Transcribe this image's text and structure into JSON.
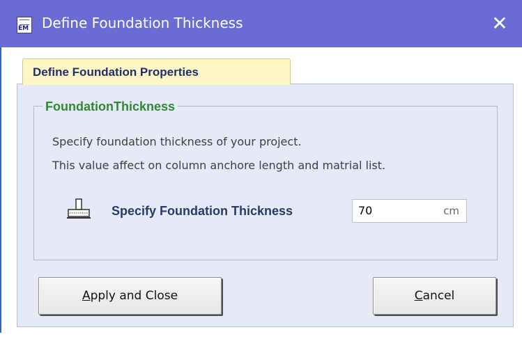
{
  "window": {
    "title": "Define Foundation Thickness",
    "icon_text": "EM",
    "close_glyph": "✕"
  },
  "tab": {
    "label": "Define Foundation Properties"
  },
  "group": {
    "title": "FoundationThickness",
    "description_line1": "Specify foundation thickness of your project.",
    "description_line2": "This value affect on column anchore length and matrial list."
  },
  "field": {
    "label": "Specify Foundation Thickness",
    "value": "70",
    "unit": "cm",
    "icon": "foundation-icon"
  },
  "buttons": {
    "apply_label": "Apply and Close",
    "apply_mnemonic": "A",
    "apply_rest": "pply and Close",
    "cancel_label": "Cancel",
    "cancel_mnemonic": "C",
    "cancel_rest": "ancel"
  },
  "colors": {
    "titlebar": "#6b6bd5",
    "tab_bg": "#fff7c4",
    "panel_bg": "#e6e9f7",
    "group_title": "#2e8b2e",
    "label_text": "#273a6a"
  }
}
